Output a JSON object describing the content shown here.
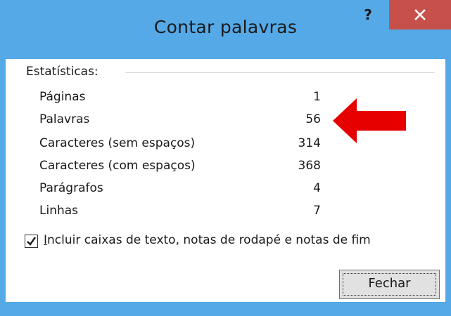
{
  "window": {
    "title": "Contar palavras",
    "help_label": "?",
    "accent_color": "#54a9e6",
    "close_color": "#c7504b"
  },
  "stats": {
    "group_label": "Estatísticas:",
    "rows": [
      {
        "label": "Páginas",
        "value": "1"
      },
      {
        "label": "Palavras",
        "value": "56"
      },
      {
        "label": "Caracteres (sem espaços)",
        "value": "314"
      },
      {
        "label": "Caracteres (com espaços)",
        "value": "368"
      },
      {
        "label": "Parágrafos",
        "value": "4"
      },
      {
        "label": "Linhas",
        "value": "7"
      }
    ]
  },
  "annotation": {
    "arrow_icon": "red-arrow-left-icon",
    "arrow_color": "#e60000"
  },
  "options": {
    "include_checkbox_checked": true,
    "include_label_mnemonic": "I",
    "include_label_rest": "ncluir caixas de texto, notas de rodapé e notas de fim"
  },
  "buttons": {
    "close_label": "Fechar"
  }
}
